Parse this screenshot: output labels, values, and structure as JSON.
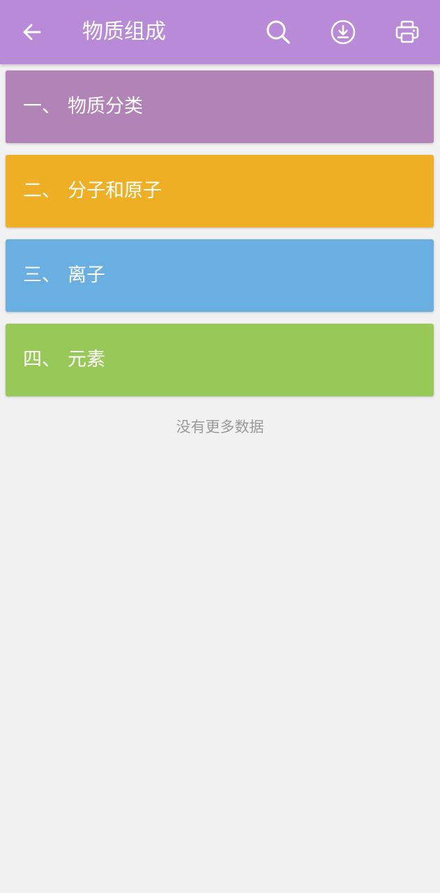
{
  "header": {
    "title": "物质组成",
    "background": "#b98ad7",
    "icons": {
      "back": "arrow-left-icon",
      "search": "search-icon",
      "download": "download-circle-icon",
      "print": "printer-icon"
    }
  },
  "categories": [
    {
      "number": "一、",
      "label": "物质分类",
      "color": "#b283b6"
    },
    {
      "number": "二、",
      "label": "分子和原子",
      "color": "#eeaf25"
    },
    {
      "number": "三、",
      "label": "离子",
      "color": "#6aafe1"
    },
    {
      "number": "四、",
      "label": "元素",
      "color": "#98c958"
    }
  ],
  "footer": {
    "text": "没有更多数据"
  }
}
